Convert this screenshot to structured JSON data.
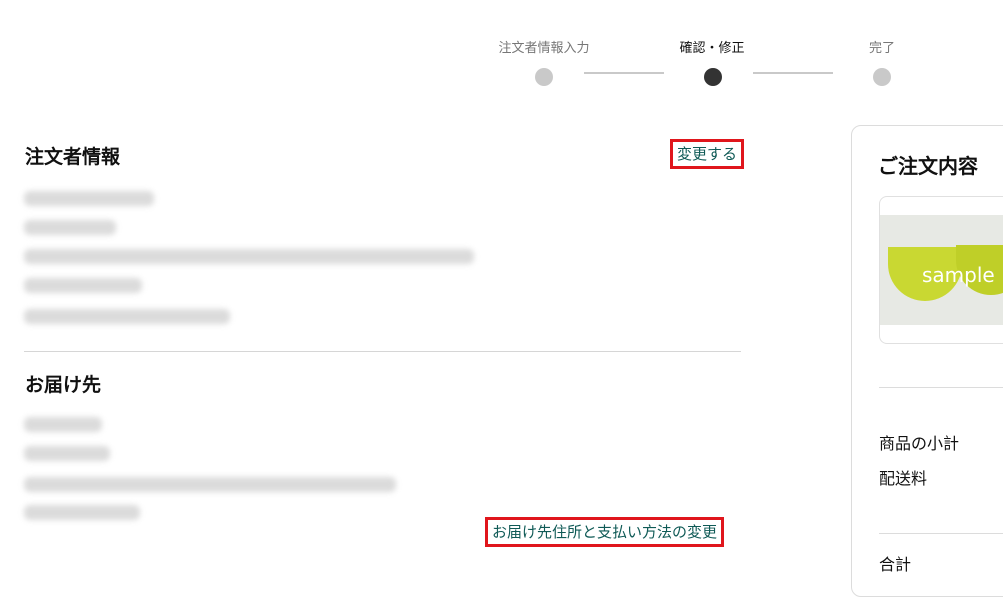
{
  "stepper": {
    "steps": [
      {
        "label": "注文者情報入力",
        "state": "done"
      },
      {
        "label": "確認・修正",
        "state": "current"
      },
      {
        "label": "完了",
        "state": "todo"
      }
    ]
  },
  "orderer": {
    "title": "注文者情報",
    "change_label": "変更する"
  },
  "delivery": {
    "title": "お届け先",
    "change_label": "お届け先住所と支払い方法の変更"
  },
  "summary": {
    "title": "ご注文内容",
    "product_image_text": "sample",
    "subtotal_label": "商品の小計",
    "shipping_label": "配送料",
    "total_label": "合計"
  },
  "colors": {
    "accent_link": "#0f5a56",
    "highlight_border": "#e0161c",
    "step_active": "#333333",
    "step_inactive": "#c9c9c9"
  }
}
